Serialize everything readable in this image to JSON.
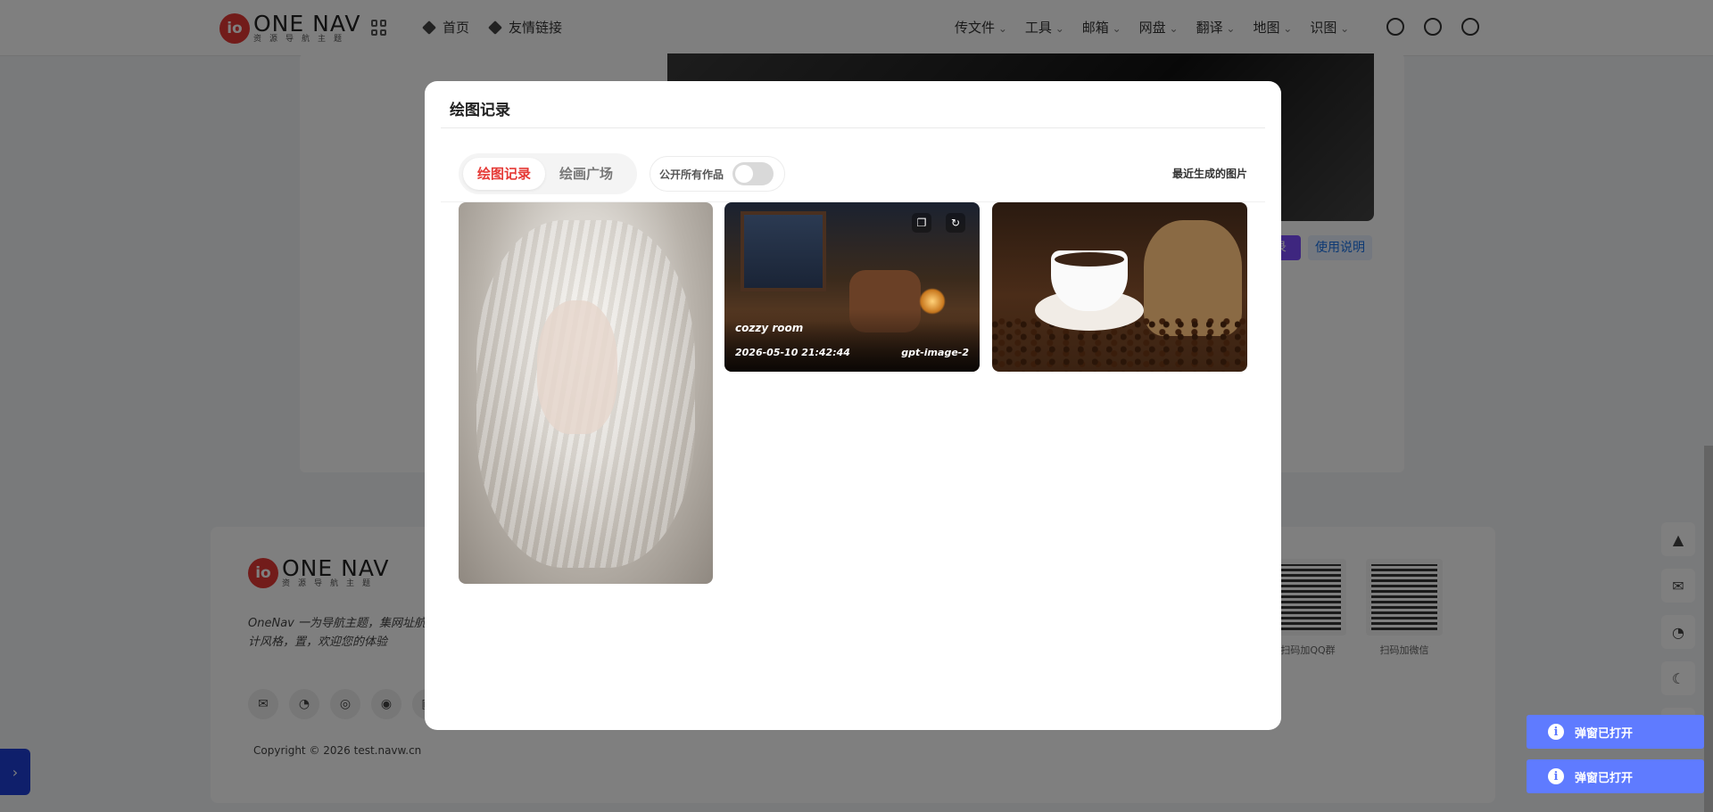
{
  "header": {
    "logo": {
      "mark": "io",
      "name": "ONE NAV",
      "subtitle": "资源导航主题"
    },
    "nav_main": [
      {
        "label": "首页",
        "icon": "layers-icon"
      },
      {
        "label": "友情链接",
        "icon": "layers-icon"
      }
    ],
    "nav_right": [
      "传文件",
      "工具",
      "邮箱",
      "网盘",
      "翻译",
      "地图",
      "识图"
    ],
    "icons": [
      "alarm-icon",
      "user-icon",
      "search-icon"
    ]
  },
  "content": {
    "buttons": {
      "purple": "录",
      "help": "使用说明"
    }
  },
  "footer": {
    "logo": {
      "mark": "io",
      "name": "ONE NAV",
      "subtitle": "资源导航主题"
    },
    "description": "OneNav 一为导航主题，集网址航主题，简约优雅的设计风格，置，欢迎您的体验",
    "copyright": "Copyright © 2026 test.navw.cn",
    "social_icons": [
      "wechat-icon",
      "qq-icon",
      "weibo-icon",
      "github-icon",
      "mail-icon"
    ],
    "qr_codes": [
      {
        "caption": "扫码加QQ群"
      },
      {
        "caption": "扫码加微信"
      }
    ]
  },
  "side_tools": [
    "arrow-up-icon",
    "wechat-icon",
    "qq-icon",
    "moon-icon",
    "edit-icon"
  ],
  "modal": {
    "title": "绘图记录",
    "tabs": [
      {
        "label": "绘图记录",
        "active": true
      },
      {
        "label": "绘画广场",
        "active": false
      }
    ],
    "public_toggle": {
      "label": "公开所有作品",
      "on": false
    },
    "recent_label": "最近生成的图片",
    "cards": [
      {
        "subject": "elf"
      },
      {
        "subject": "room",
        "title": "cozzy room",
        "time": "2026-05-10 21:42:44",
        "model": "gpt-image-2",
        "actions": [
          "copy-icon",
          "refresh-icon"
        ]
      },
      {
        "subject": "coffee"
      }
    ]
  },
  "toasts": [
    {
      "text": "弹窗已打开",
      "icon": "info-icon"
    },
    {
      "text": "弹窗已打开",
      "icon": "info-icon"
    }
  ],
  "colors": {
    "accent_red": "#e53935",
    "toast_blue": "#5f7bff",
    "side_tab_blue": "#1e3fd6",
    "overlay": "rgba(0,0,0,0.5)"
  }
}
